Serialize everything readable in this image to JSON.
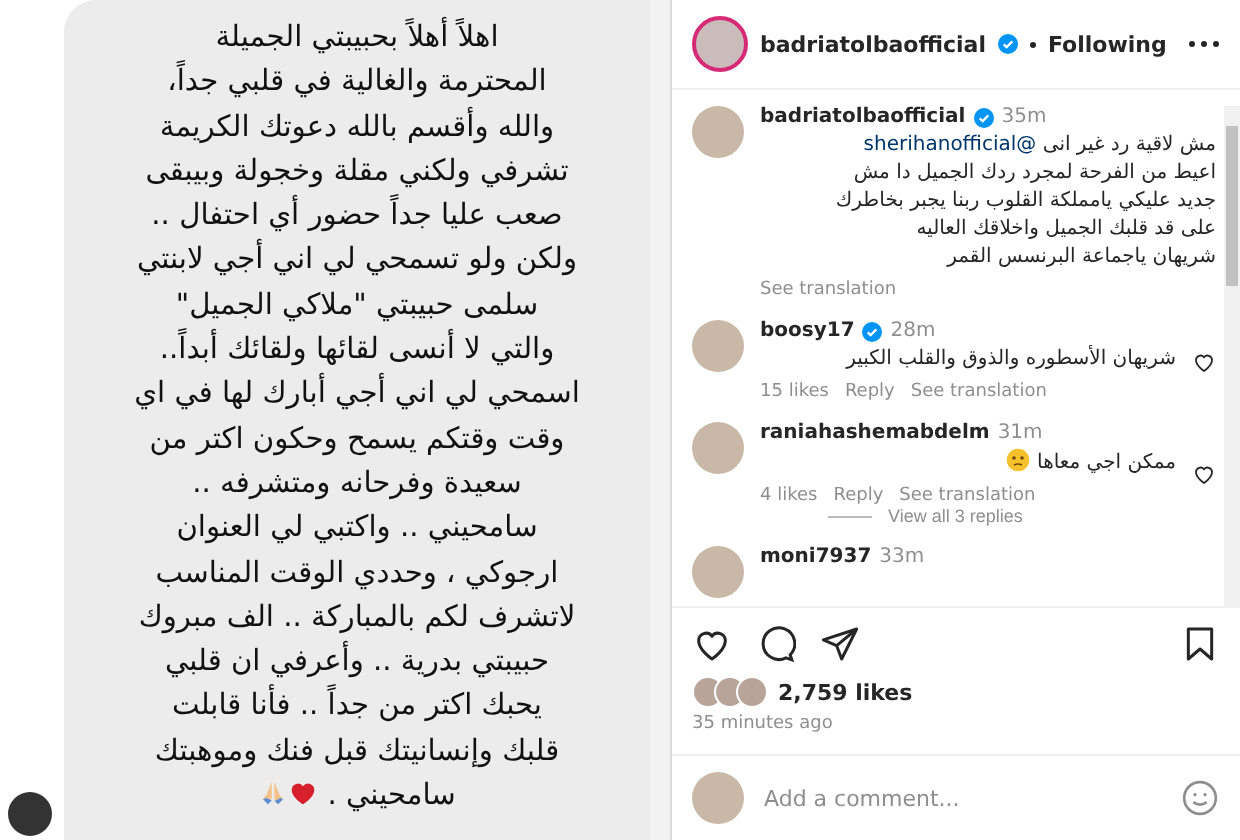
{
  "message": {
    "lines": [
      "اهلاً أهلاً بحبيبتي الجميلة",
      "المحترمة والغالية في قلبي جداً،",
      "والله وأقسم بالله دعوتك الكريمة",
      "تشرفي ولكني مقلة وخجولة وبيبقى",
      "صعب عليا جداً حضور أي احتفال ..",
      "ولكن ولو تسمحي لي اني أجي لابنتي",
      "سلمى حبيبتي \"ملاكي الجميل\"",
      "والتي لا أنسى لقائها ولقائك أبداً..",
      "اسمحي لي اني أجي أبارك لها في اي",
      "وقت وقتكم يسمح وحكون اكتر من",
      "سعيدة وفرحانه ومتشرفه ..",
      "سامحيني .. واكتبي لي العنوان",
      "ارجوكي ، وحددي الوقت المناسب",
      "لاتشرف لكم بالمباركة .. الف مبروك",
      "حبيبتي بدرية .. وأعرفي ان قلبي",
      "يحبك اكتر من جداً .. فأنا قابلت",
      "قلبك وإنسانيتك قبل فنك وموهبتك",
      "سامحيني ."
    ]
  },
  "post": {
    "author": {
      "username": "badriatolbaofficial",
      "verified": true,
      "follow_status": "Following"
    },
    "comments": [
      {
        "kind": "caption",
        "username": "badriatolbaofficial",
        "verified": true,
        "time": "35m",
        "mention": "@sherihanofficial",
        "lines": [
          "مش لاقية رد غير انى",
          "اعيط من الفرحة لمجرد ردك الجميل دا مش",
          "جديد عليكي يامملكة القلوب ربنا يجبر بخاطرك",
          "على قد قلبك الجميل واخلاقك العاليه",
          "شريهان ياجماعة البرنسس القمر"
        ],
        "translation_link": "See translation"
      },
      {
        "kind": "comment",
        "username": "boosy17",
        "verified": true,
        "time": "28m",
        "lines": [
          "شريهان الأسطوره والذوق والقلب الكبير"
        ],
        "likes": "15 likes",
        "reply_link": "Reply",
        "translation_link": "See translation"
      },
      {
        "kind": "comment",
        "username": "raniahashemabdelm",
        "verified": false,
        "time": "31m",
        "lines": [
          "ممكن اجي معاها"
        ],
        "emoji": true,
        "likes": "4 likes",
        "reply_link": "Reply",
        "translation_link": "See translation",
        "replies": "View all 3 replies"
      },
      {
        "kind": "comment",
        "username": "moni7937",
        "verified": false,
        "time": "33m"
      }
    ],
    "likes": "2,759 likes",
    "time_ago": "35 minutes ago",
    "comment_field": {
      "placeholder": "Add a comment..."
    }
  }
}
